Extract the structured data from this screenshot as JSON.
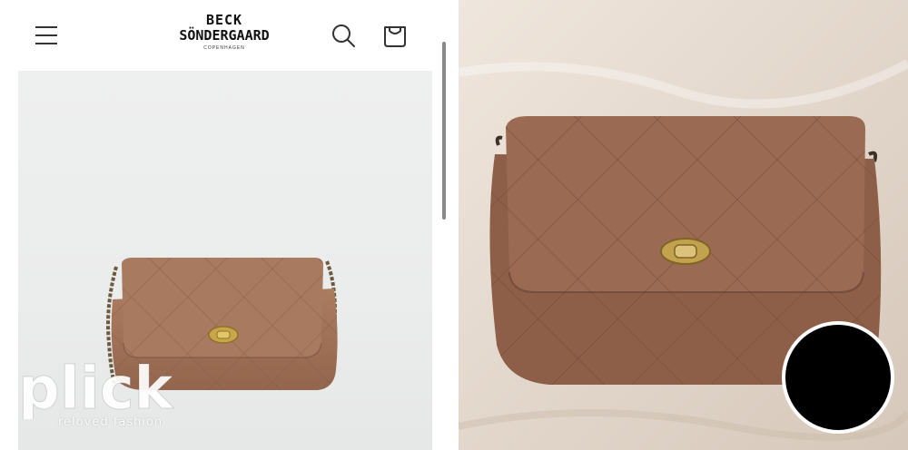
{
  "store": {
    "brand_logo": "BECK SÖNDERGAARD COPENHAGEN",
    "header_icons": [
      "hamburger-menu-icon",
      "search-icon",
      "cart-icon"
    ]
  },
  "product": {
    "image": "brown quilted suede shoulder bag with gold twist lock and chain strap",
    "background_color": "#ebecec",
    "bag_color": "#a3755a"
  },
  "user_photo": {
    "image": "brown quilted suede bag lying on a white bed sheet",
    "bag_color": "#93634c"
  },
  "watermark": {
    "logo": "plick",
    "tagline": "reloved fashion"
  },
  "seller": {
    "avatar_color": "#000000"
  }
}
